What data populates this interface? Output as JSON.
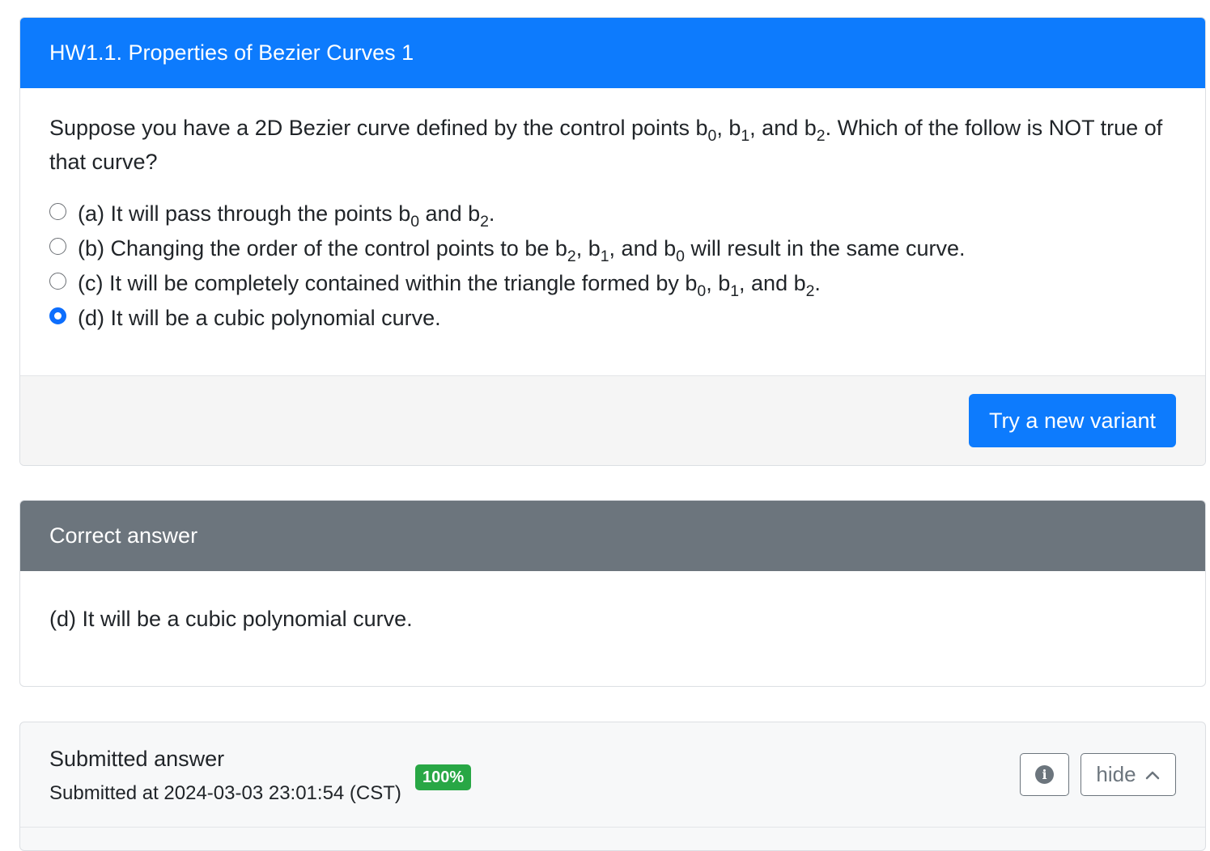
{
  "question": {
    "title": "HW1.1. Properties of Bezier Curves 1",
    "prompt_html": "Suppose you have a 2D Bezier curve defined by the control points b<sub>0</sub>, b<sub>1</sub>, and b<sub>2</sub>. Which of the follow is NOT true of that curve?",
    "options": [
      {
        "label_html": "(a) It will pass through the points b<sub>0</sub> and b<sub>2</sub>.",
        "checked": false
      },
      {
        "label_html": "(b) Changing the order of the control points to be b<sub>2</sub>, b<sub>1</sub>, and b<sub>0</sub> will result in the same curve.",
        "checked": false
      },
      {
        "label_html": "(c) It will be completely contained within the triangle formed by b<sub>0</sub>, b<sub>1</sub>, and b<sub>2</sub>.",
        "checked": false
      },
      {
        "label_html": "(d) It will be a cubic polynomial curve.",
        "checked": true
      }
    ],
    "new_variant_label": "Try a new variant"
  },
  "correct_answer": {
    "title": "Correct answer",
    "text": "(d) It will be a cubic polynomial curve."
  },
  "submitted_answer": {
    "title": "Submitted answer",
    "timestamp": "Submitted at 2024-03-03 23:01:54 (CST)",
    "score_badge": "100%",
    "hide_label": "hide",
    "info_icon": "info-circle-icon",
    "chevron_icon": "chevron-up-icon"
  },
  "colors": {
    "primary": "#0d7bfd",
    "secondary": "#6c757d",
    "success": "#28a745"
  }
}
